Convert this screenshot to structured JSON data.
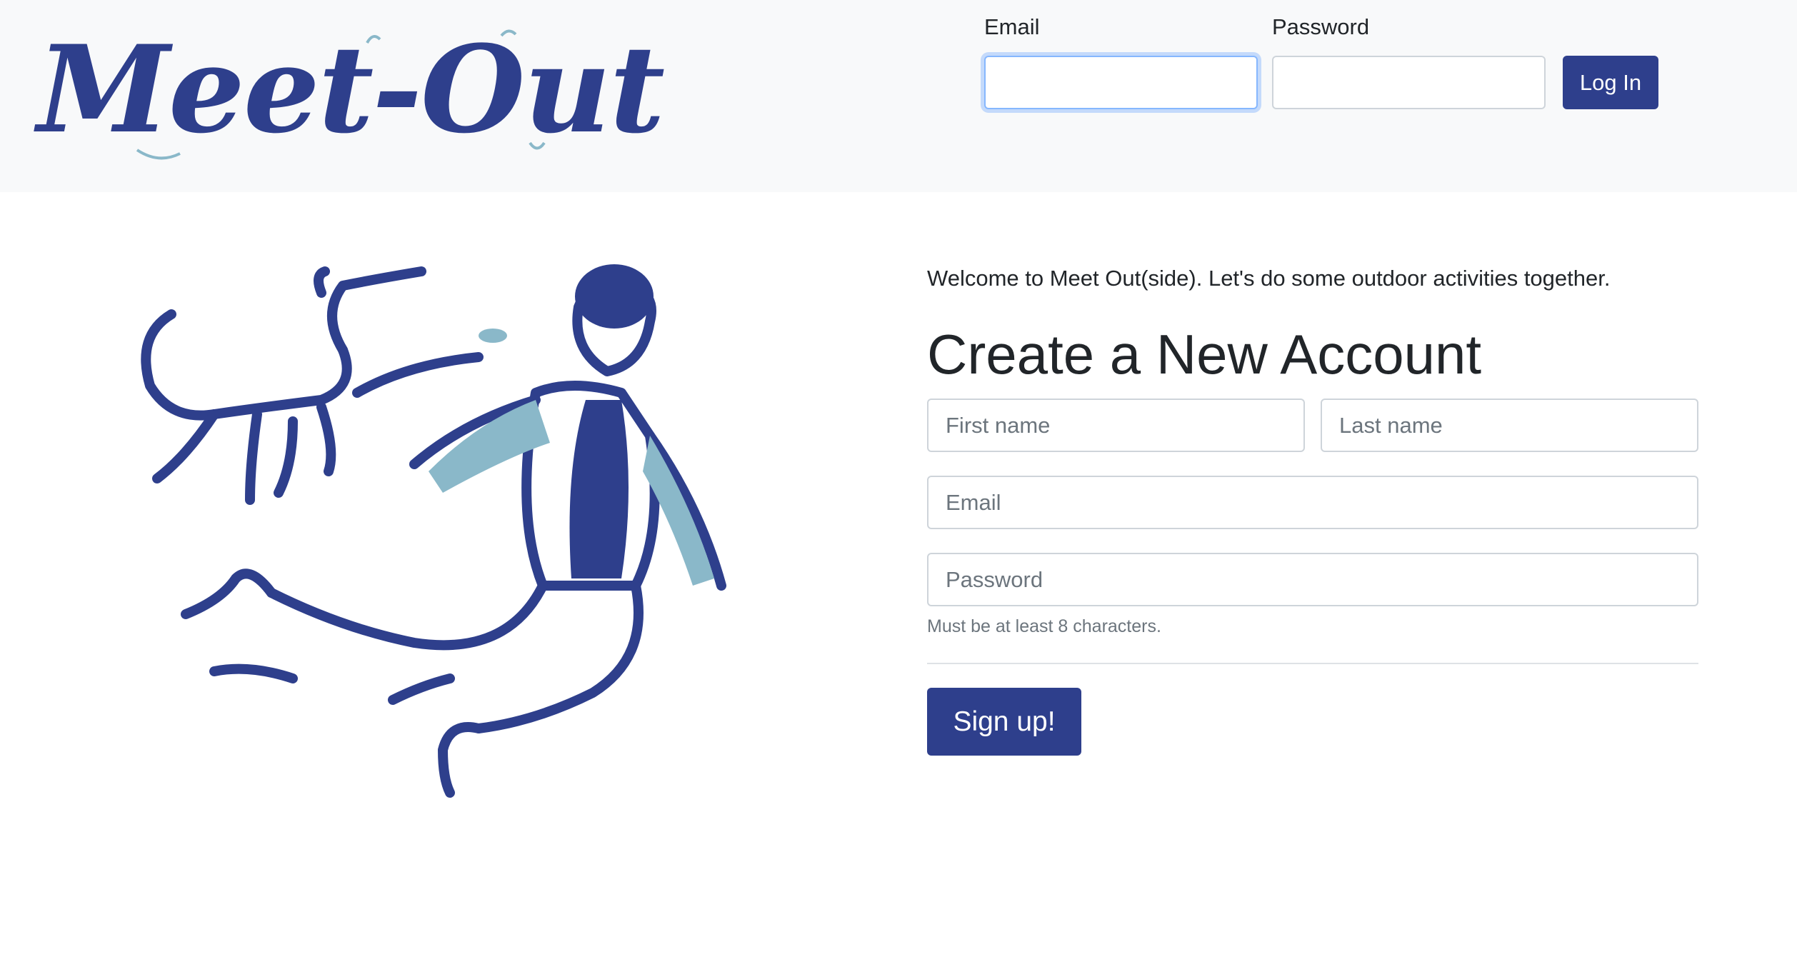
{
  "header": {
    "logo_text": "Meet-Out",
    "login": {
      "email_label": "Email",
      "email_value": "",
      "password_label": "Password",
      "password_value": "",
      "submit_label": "Log In"
    }
  },
  "main": {
    "welcome_text": "Welcome to Meet Out(side). Let's do some outdoor activities together.",
    "title": "Create a New Account",
    "fields": {
      "first_name_placeholder": "First name",
      "last_name_placeholder": "Last name",
      "email_placeholder": "Email",
      "password_placeholder": "Password"
    },
    "password_hint": "Must be at least 8 characters.",
    "signup_label": "Sign up!"
  },
  "colors": {
    "brand": "#2e3f8c",
    "accent_light": "#8ab8c9",
    "header_bg": "#f8f9fa"
  },
  "illustration": {
    "icon": "person-jumping-with-dog-illustration"
  }
}
